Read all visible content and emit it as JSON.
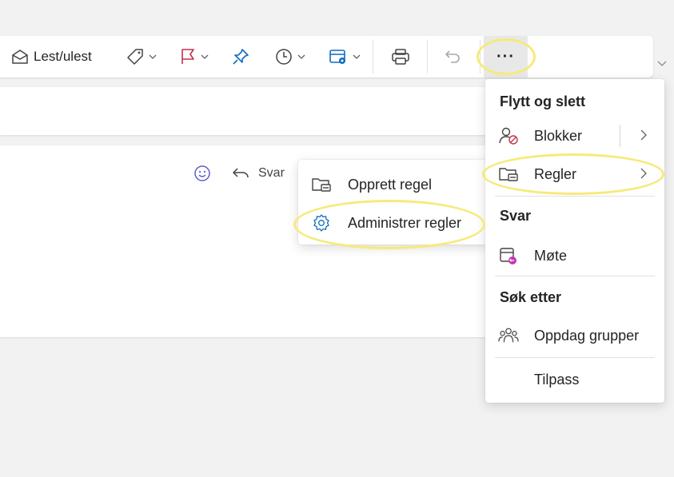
{
  "toolbar": {
    "read_unread_label": "Lest/ulest",
    "more_label": "···"
  },
  "reading": {
    "reply_label": "Svar"
  },
  "submenu": {
    "items": [
      {
        "label": "Opprett regel",
        "icon": "folder-rule-icon"
      },
      {
        "label": "Administrer regler",
        "icon": "gear-icon"
      }
    ]
  },
  "menu": {
    "sections": {
      "move_delete": "Flytt og slett",
      "reply": "Svar",
      "search": "Søk etter"
    },
    "items": {
      "block": "Blokker",
      "rules": "Regler",
      "meeting": "Møte",
      "discover_groups": "Oppdag grupper",
      "customize": "Tilpass"
    }
  },
  "colors": {
    "accent": "#0f6cbd",
    "flag": "#c4314b",
    "highlight": "#f6ea7a",
    "emoji": "#5b5fc7"
  }
}
